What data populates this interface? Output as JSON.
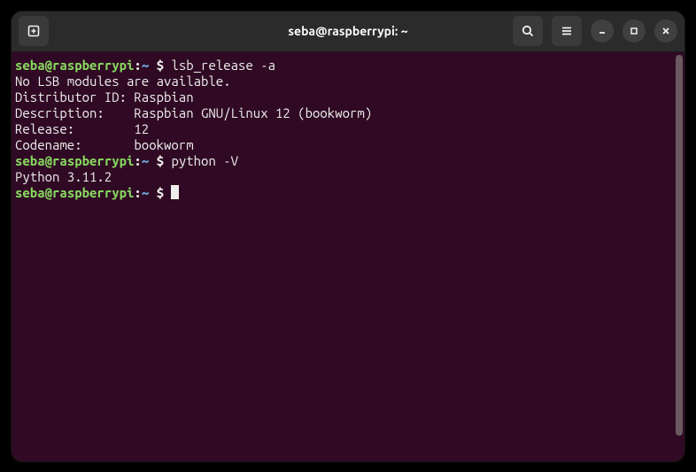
{
  "titlebar": {
    "title": "seba@raspberrypi: ~"
  },
  "prompt": {
    "user": "seba",
    "at": "@",
    "host": "raspberrypi",
    "colon": ":",
    "path": "~",
    "dollar": "$"
  },
  "session": {
    "cmd1": "lsb_release -a",
    "out1_l1": "No LSB modules are available.",
    "out1_l2": "Distributor ID: Raspbian",
    "out1_l3": "Description:    Raspbian GNU/Linux 12 (bookworm)",
    "out1_l4": "Release:        12",
    "out1_l5": "Codename:       bookworm",
    "cmd2": "python -V",
    "out2_l1": "Python 3.11.2"
  }
}
